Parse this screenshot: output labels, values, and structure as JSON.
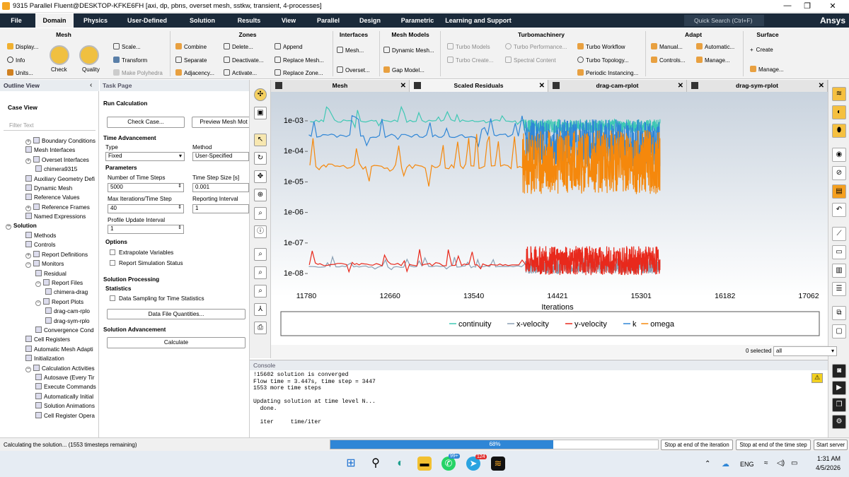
{
  "window": {
    "title": "9315 Parallel Fluent@DESKTOP-KFKE6FH  [axi, dp, pbns, overset mesh, sstkw, transient, 4-processes]"
  },
  "menu": [
    "File",
    "Domain",
    "Physics",
    "User-Defined",
    "Solution",
    "Results",
    "View",
    "Parallel",
    "Design",
    "Parametric",
    "Learning and Support"
  ],
  "quick_search": "Quick Search (Ctrl+F)",
  "brand": "Ansys",
  "ribbon": {
    "groups": [
      "Mesh",
      "Zones",
      "Interfaces",
      "Mesh Models",
      "Turbomachinery",
      "Adapt",
      "Surface"
    ],
    "mesh": [
      "Display...",
      "Info",
      "Units...",
      "Check",
      "Quality",
      "Scale...",
      "Transform",
      "Make Polyhedra"
    ],
    "zones": [
      "Combine",
      "Separate",
      "Adjacency...",
      "Delete...",
      "Deactivate...",
      "Activate...",
      "Append",
      "Replace Mesh...",
      "Replace Zone..."
    ],
    "interfaces": [
      "Mesh...",
      "Overset..."
    ],
    "mesh_models": [
      "Dynamic Mesh...",
      "Gap Model..."
    ],
    "turbo": [
      "Turbo Models",
      "Turbo Create...",
      "Turbo Performance...",
      "Spectral Content",
      "Turbo Workflow",
      "Turbo Topology...",
      "Periodic Instancing..."
    ],
    "adapt": [
      "Manual...",
      "Automatic...",
      "Controls...",
      "Manage..."
    ],
    "surface": [
      "Create",
      "Manage..."
    ]
  },
  "outline": {
    "header": "Outline View",
    "case_view": "Case View",
    "filter_placeholder": "Filter Text",
    "items": [
      "Boundary Conditions",
      "Mesh Interfaces",
      "Overset Interfaces",
      "chimera9315",
      "Auxiliary Geometry Defi",
      "Dynamic Mesh",
      "Reference Values",
      "Reference Frames",
      "Named Expressions",
      "Solution",
      "Methods",
      "Controls",
      "Report Definitions",
      "Monitors",
      "Residual",
      "Report Files",
      "chimera-drag",
      "Report Plots",
      "drag-cam-rplo",
      "drag-sym-rplo",
      "Convergence Cond",
      "Cell Registers",
      "Automatic Mesh Adapti",
      "Initialization",
      "Calculation Activities",
      "Autosave (Every Tir",
      "Execute Commands",
      "Automatically Initial",
      "Solution Animations",
      "Cell Register Opera"
    ]
  },
  "task": {
    "header": "Task Page",
    "title": "Run Calculation",
    "check_case": "Check Case...",
    "preview_mesh": "Preview Mesh Mot",
    "time_advancement": "Time Advancement",
    "type_label": "Type",
    "type_value": "Fixed",
    "method_label": "Method",
    "method_value": "User-Specified",
    "parameters": "Parameters",
    "n_steps_label": "Number of Time Steps",
    "n_steps": "5000",
    "step_size_label": "Time Step Size [s]",
    "step_size": "0.001",
    "max_iter_label": "Max Iterations/Time Step",
    "max_iter": "40",
    "report_label": "Reporting Interval",
    "report_interval": "1",
    "profile_label": "Profile Update Interval",
    "profile_interval": "1",
    "options": "Options",
    "extrapolate": "Extrapolate Variables",
    "report_status": "Report Simulation Status",
    "solution_processing": "Solution Processing",
    "statistics": "Statistics",
    "data_sampling": "Data Sampling for Time Statistics",
    "data_file_qty": "Data File Quantities...",
    "solution_advancement": "Solution Advancement",
    "calculate": "Calculate"
  },
  "plot_tabs": [
    "Mesh",
    "Scaled Residuals",
    "drag-cam-rplot",
    "drag-sym-rplot"
  ],
  "chart_data": {
    "type": "line",
    "xlabel": "Iterations",
    "x_ticks": [
      "11780",
      "12660",
      "13540",
      "14421",
      "15301",
      "16182",
      "17062"
    ],
    "xlim": [
      11780,
      17062
    ],
    "y_ticks": [
      "1e-03",
      "1e-04",
      "1e-05",
      "1e-06",
      "1e-07",
      "1e-08"
    ],
    "ylim_log10": [
      -8.3,
      -2.7
    ],
    "yscale": "log",
    "legend_position": "bottom",
    "series": [
      {
        "name": "continuity",
        "color": "#3fc8b4",
        "approx_range": [
          0.0008,
          0.001
        ]
      },
      {
        "name": "x-velocity",
        "color": "#8aa0b4",
        "approx_range": [
          1e-08,
          2e-08
        ]
      },
      {
        "name": "y-velocity",
        "color": "#e8291c",
        "approx_range": [
          1e-08,
          6e-08
        ]
      },
      {
        "name": "k",
        "color": "#2f86d6",
        "approx_range": [
          2e-05,
          0.001
        ]
      },
      {
        "name": "omega",
        "color": "#f5880c",
        "approx_range": [
          5e-06,
          0.0004
        ]
      }
    ]
  },
  "selection": {
    "text": "0 selected",
    "value": "all"
  },
  "console": {
    "header": "Console",
    "lines": [
      "!15602 solution is converged",
      "Flow time = 3.447s, time step = 3447",
      "1553 more time steps",
      "",
      "Updating solution at time level N...",
      "  done.",
      "",
      "  iter     time/iter"
    ]
  },
  "status": {
    "message": "Calculating the solution... (1553 timesteps remaining)",
    "progress": 0.68,
    "progress_label": "68%",
    "stop_iter": "Stop at end of the iteration",
    "stop_step": "Stop at end of the time step",
    "start_server": "Start server"
  },
  "taskbar": {
    "lang": "ENG",
    "time": "1:31 AM",
    "date": "4/5/2026",
    "badge1": "99+",
    "badge2": "124"
  }
}
